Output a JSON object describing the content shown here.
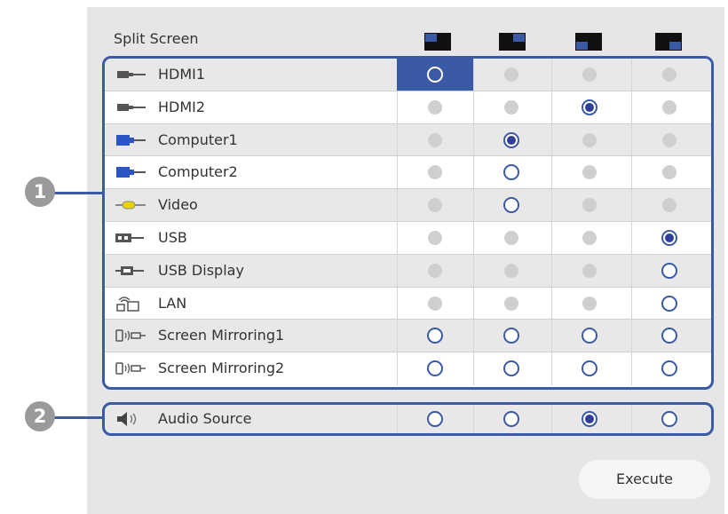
{
  "title": "Split Screen",
  "layout_columns": [
    "layout-top-left-icon",
    "layout-top-right-icon",
    "layout-bottom-left-icon",
    "layout-bottom-right-icon"
  ],
  "sources": [
    {
      "label": "HDMI1",
      "icon": "hdmi-icon",
      "states": [
        "focused",
        "disabled",
        "disabled",
        "disabled"
      ]
    },
    {
      "label": "HDMI2",
      "icon": "hdmi-icon",
      "states": [
        "disabled",
        "disabled",
        "checked",
        "disabled"
      ]
    },
    {
      "label": "Computer1",
      "icon": "computer-icon",
      "states": [
        "disabled",
        "checked",
        "disabled",
        "disabled"
      ]
    },
    {
      "label": "Computer2",
      "icon": "computer-icon",
      "states": [
        "disabled",
        "empty",
        "disabled",
        "disabled"
      ]
    },
    {
      "label": "Video",
      "icon": "video-icon",
      "states": [
        "disabled",
        "empty",
        "disabled",
        "disabled"
      ]
    },
    {
      "label": "USB",
      "icon": "usb-icon",
      "states": [
        "disabled",
        "disabled",
        "disabled",
        "checked"
      ]
    },
    {
      "label": "USB Display",
      "icon": "usb-display-icon",
      "states": [
        "disabled",
        "disabled",
        "disabled",
        "empty"
      ]
    },
    {
      "label": "LAN",
      "icon": "lan-icon",
      "states": [
        "disabled",
        "disabled",
        "disabled",
        "empty"
      ]
    },
    {
      "label": "Screen Mirroring1",
      "icon": "screen-mirroring-icon",
      "states": [
        "empty",
        "empty",
        "empty",
        "empty"
      ]
    },
    {
      "label": "Screen Mirroring2",
      "icon": "screen-mirroring-icon",
      "states": [
        "empty",
        "empty",
        "empty",
        "empty"
      ]
    }
  ],
  "audio": {
    "label": "Audio Source",
    "icon": "speaker-icon",
    "states": [
      "empty",
      "empty",
      "checked",
      "empty"
    ]
  },
  "callouts": [
    "1",
    "2"
  ],
  "execute_label": "Execute",
  "colors": {
    "accent": "#3b5aa6",
    "radio_dot": "#2e3f9a",
    "panel": "#e6e6e6",
    "callout": "#9a9a9a"
  }
}
